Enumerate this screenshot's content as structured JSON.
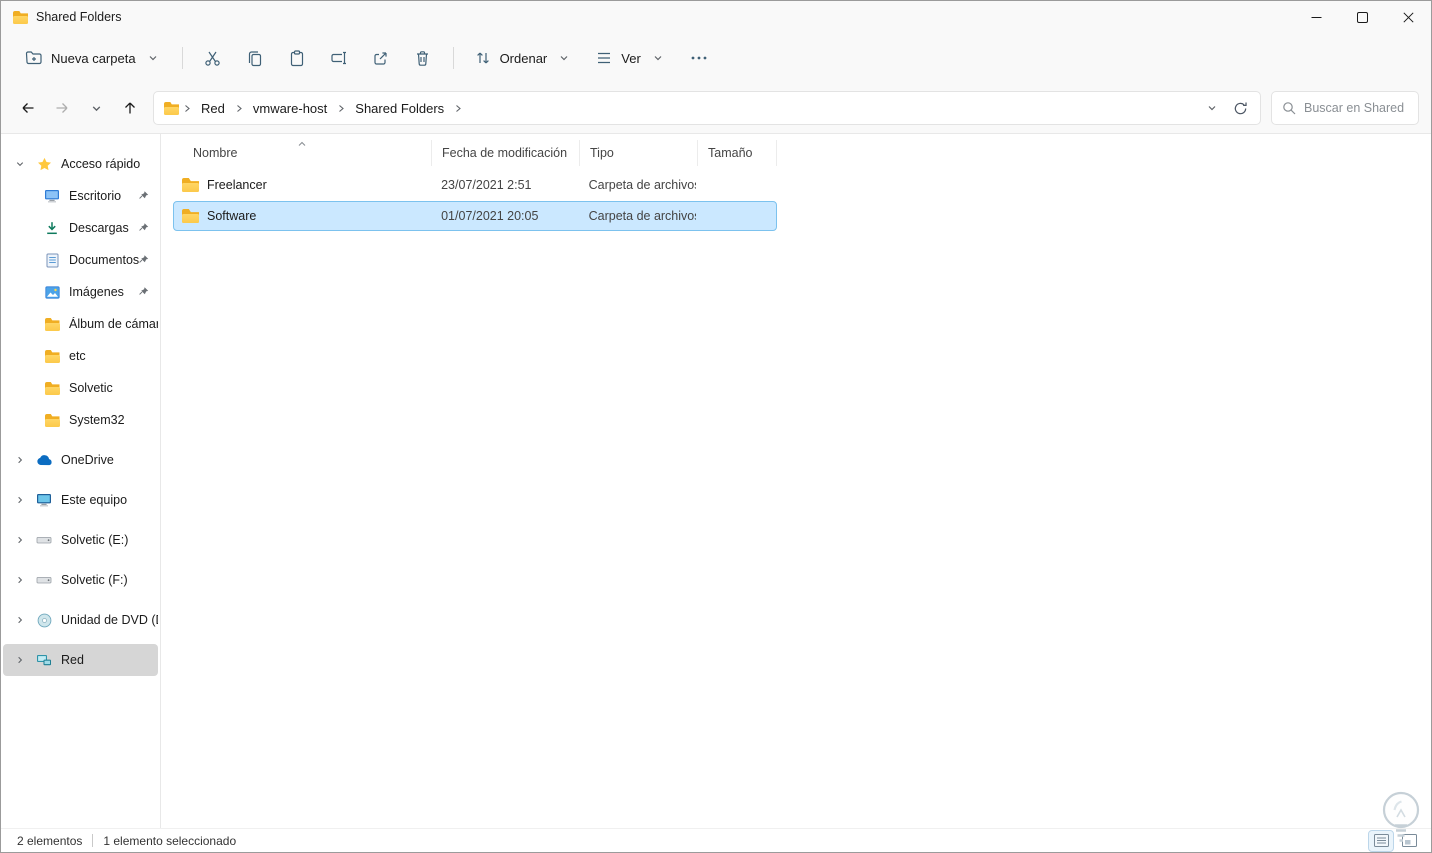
{
  "window": {
    "title": "Shared Folders"
  },
  "toolbar": {
    "new_folder_label": "Nueva carpeta",
    "sort_label": "Ordenar",
    "view_label": "Ver"
  },
  "address_bar": {
    "crumbs": [
      "Red",
      "vmware-host",
      "Shared Folders"
    ],
    "search_placeholder": "Buscar en Shared ..."
  },
  "sidebar": {
    "quick_access_label": "Acceso rápido",
    "quick_items": [
      {
        "label": "Escritorio",
        "pinned": true
      },
      {
        "label": "Descargas",
        "pinned": true
      },
      {
        "label": "Documentos",
        "pinned": true
      },
      {
        "label": "Imágenes",
        "pinned": true
      },
      {
        "label": "Álbum de cámara",
        "pinned": false
      },
      {
        "label": "etc",
        "pinned": false
      },
      {
        "label": "Solvetic",
        "pinned": false
      },
      {
        "label": "System32",
        "pinned": false
      }
    ],
    "root_items": [
      {
        "label": "OneDrive",
        "selected": false
      },
      {
        "label": "Este equipo",
        "selected": false
      },
      {
        "label": "Solvetic (E:)",
        "selected": false
      },
      {
        "label": "Solvetic (F:)",
        "selected": false
      },
      {
        "label": "Unidad de DVD (D:)",
        "selected": false
      },
      {
        "label": "Red",
        "selected": true
      }
    ]
  },
  "file_list": {
    "columns": {
      "name": "Nombre",
      "modified": "Fecha de modificación",
      "type": "Tipo",
      "size": "Tamaño"
    },
    "sort": {
      "column": "Nombre",
      "direction": "ascending"
    },
    "rows": [
      {
        "name": "Freelancer",
        "modified": "23/07/2021 2:51",
        "type": "Carpeta de archivos",
        "size": "",
        "selected": false
      },
      {
        "name": "Software",
        "modified": "01/07/2021 20:05",
        "type": "Carpeta de archivos",
        "size": "",
        "selected": true
      }
    ]
  },
  "status_bar": {
    "items_count": "2 elementos",
    "selection_count": "1 elemento seleccionado"
  },
  "icons": {
    "new_folder": "folder-plus",
    "cut": "scissors",
    "copy": "two-pages",
    "paste": "clipboard",
    "rename": "text-box-cursor",
    "share": "arrow-out-of-box",
    "delete": "trash-can",
    "sort": "up-down-arrows",
    "view": "list-lines",
    "more": "ellipsis",
    "back": "arrow-left",
    "forward": "arrow-right",
    "history": "chevron-down",
    "up": "arrow-up",
    "refresh": "circular-arrow",
    "search": "magnifier",
    "sort_ascending": "caret-up",
    "pin": "pushpin",
    "lightbulb": "lightbulb-sketch"
  },
  "colors": {
    "selection_fill": "#cbe8ff",
    "selection_border": "#7cc2ee",
    "sidebar_selected": "#d6d6d6",
    "folder_yellow": "#fcc94a",
    "chrome_background": "#f9f9f9"
  }
}
